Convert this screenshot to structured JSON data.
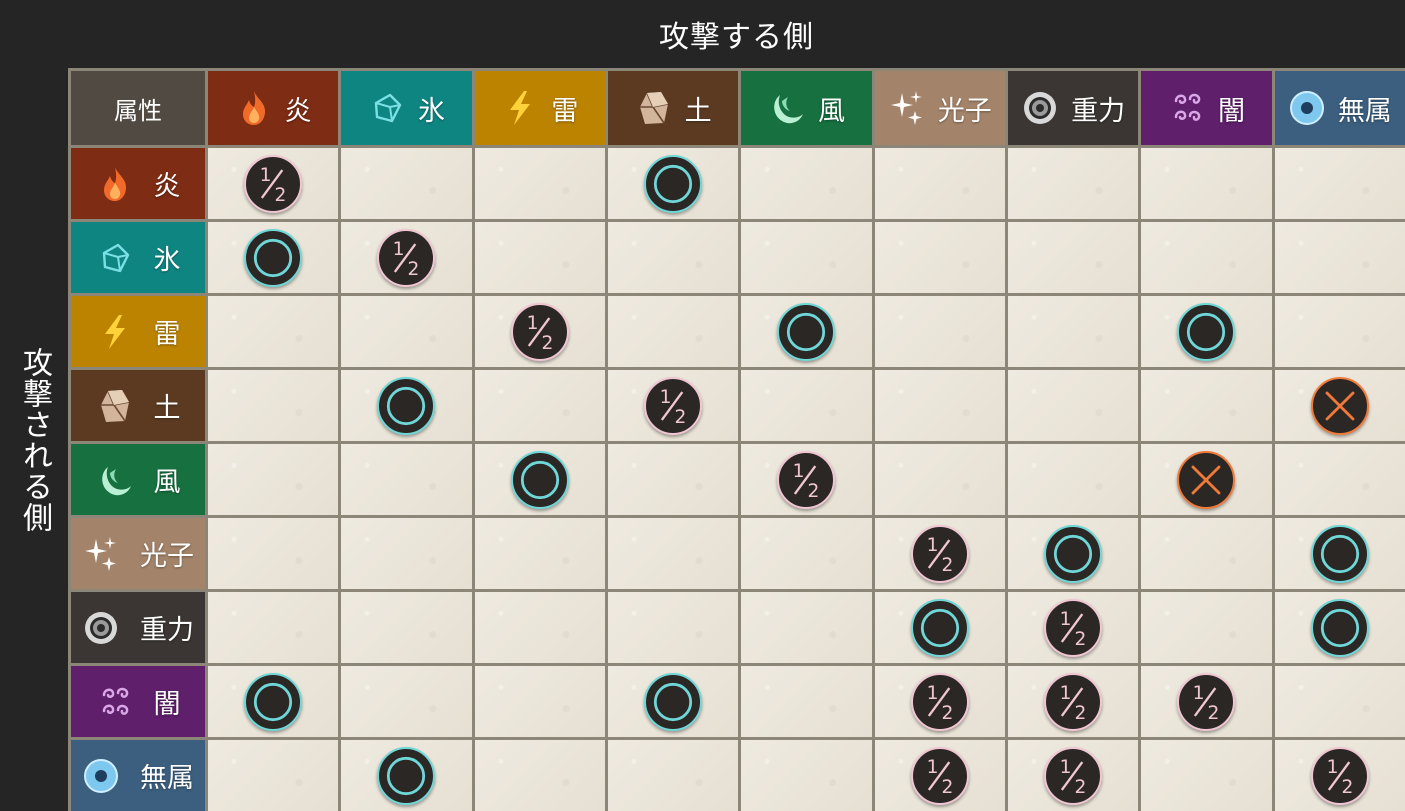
{
  "titles": {
    "attacker": "攻撃する側",
    "defender": "攻撃される側"
  },
  "corner_label": "属性",
  "elements": [
    {
      "name": "炎",
      "icon": "flame-icon",
      "color": "#7e2c14"
    },
    {
      "name": "氷",
      "icon": "ice-crystal-icon",
      "color": "#0f8582"
    },
    {
      "name": "雷",
      "icon": "lightning-icon",
      "color": "#bc8300"
    },
    {
      "name": "土",
      "icon": "rock-icon",
      "color": "#5c3a22"
    },
    {
      "name": "風",
      "icon": "wind-crescent-icon",
      "color": "#17703f"
    },
    {
      "name": "光子",
      "icon": "sparkle-icon",
      "color": "#a3846a"
    },
    {
      "name": "重力",
      "icon": "gravity-ring-icon",
      "color": "#3b3633"
    },
    {
      "name": "闇",
      "icon": "dark-swirl-icon",
      "color": "#5f1f6b"
    },
    {
      "name": "無属",
      "icon": "neutral-orb-icon",
      "color": "#3c5f7f"
    }
  ],
  "mark_colors": {
    "half": "#f0c6d3",
    "circle": "#6fd7d7",
    "cross": "#f07a3a"
  },
  "mark_symbols": {
    "half": "½",
    "circle": "○",
    "cross": "×"
  },
  "matrix": [
    [
      "half",
      "",
      "",
      "circle",
      "",
      "",
      "",
      "",
      ""
    ],
    [
      "circle",
      "half",
      "",
      "",
      "",
      "",
      "",
      "",
      ""
    ],
    [
      "",
      "",
      "half",
      "",
      "circle",
      "",
      "",
      "circle",
      ""
    ],
    [
      "",
      "circle",
      "",
      "half",
      "",
      "",
      "",
      "",
      "cross"
    ],
    [
      "",
      "",
      "circle",
      "",
      "half",
      "",
      "",
      "cross",
      ""
    ],
    [
      "",
      "",
      "",
      "",
      "",
      "half",
      "circle",
      "",
      "circle"
    ],
    [
      "",
      "",
      "",
      "",
      "",
      "circle",
      "half",
      "",
      "circle"
    ],
    [
      "circle",
      "",
      "",
      "circle",
      "",
      "half",
      "half",
      "half",
      ""
    ],
    [
      "",
      "circle",
      "",
      "",
      "",
      "half",
      "half",
      "",
      "half"
    ]
  ]
}
